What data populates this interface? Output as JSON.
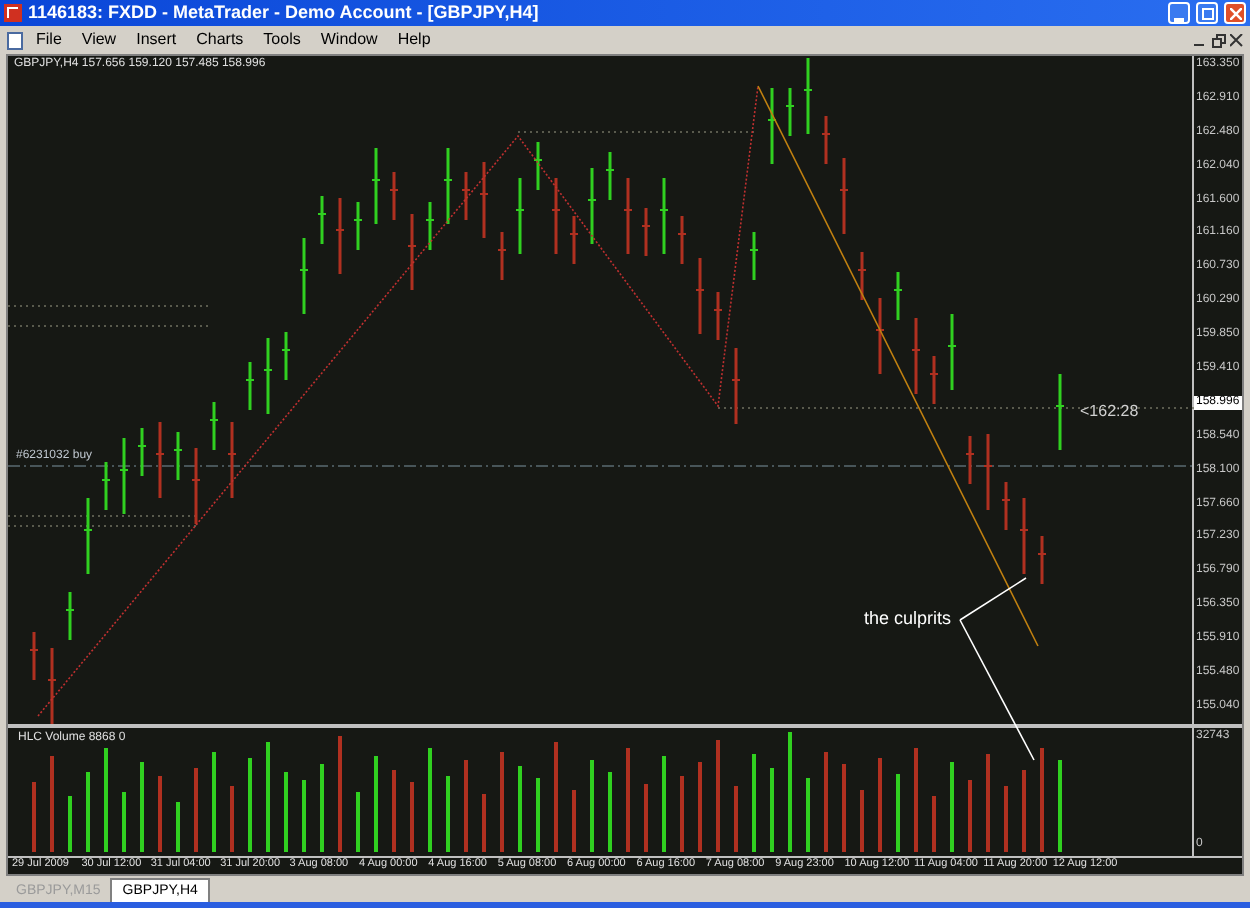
{
  "window": {
    "title": "1146183: FXDD - MetaTrader - Demo Account - [GBPJPY,H4]"
  },
  "menu": [
    "File",
    "View",
    "Insert",
    "Charts",
    "Tools",
    "Window",
    "Help"
  ],
  "chart": {
    "header": "GBPJPY,H4  157.656 159.120 157.485 158.996",
    "price_axis": [
      {
        "label": "163.350",
        "current": false
      },
      {
        "label": "162.910",
        "current": false
      },
      {
        "label": "162.480",
        "current": false
      },
      {
        "label": "162.040",
        "current": false
      },
      {
        "label": "161.600",
        "current": false
      },
      {
        "label": "161.160",
        "current": false
      },
      {
        "label": "160.730",
        "current": false
      },
      {
        "label": "160.290",
        "current": false
      },
      {
        "label": "159.850",
        "current": false
      },
      {
        "label": "159.410",
        "current": false
      },
      {
        "label": "158.996",
        "current": true
      },
      {
        "label": "158.540",
        "current": false
      },
      {
        "label": "158.100",
        "current": false
      },
      {
        "label": "157.660",
        "current": false
      },
      {
        "label": "157.230",
        "current": false
      },
      {
        "label": "156.790",
        "current": false
      },
      {
        "label": "156.350",
        "current": false
      },
      {
        "label": "155.910",
        "current": false
      },
      {
        "label": "155.480",
        "current": false
      },
      {
        "label": "155.040",
        "current": false
      }
    ],
    "order_label": "#6231032 buy",
    "bar_timer": "<162:28",
    "annotation": "the culprits",
    "volume_header": "HLC Volume 8868 0",
    "volume_axis": [
      "32743",
      "0"
    ],
    "time_axis": [
      "29 Jul 2009",
      "30 Jul 12:00",
      "31 Jul 04:00",
      "31 Jul 20:00",
      "3 Aug 08:00",
      "4 Aug 00:00",
      "4 Aug 16:00",
      "5 Aug 08:00",
      "6 Aug 00:00",
      "6 Aug 16:00",
      "7 Aug 08:00",
      "9 Aug 23:00",
      "10 Aug 12:00",
      "11 Aug 04:00",
      "11 Aug 20:00",
      "12 Aug 12:00"
    ]
  },
  "tabs": [
    {
      "label": "GBPJPY,M15",
      "selected": false
    },
    {
      "label": "GBPJPY,H4",
      "selected": true
    }
  ]
}
